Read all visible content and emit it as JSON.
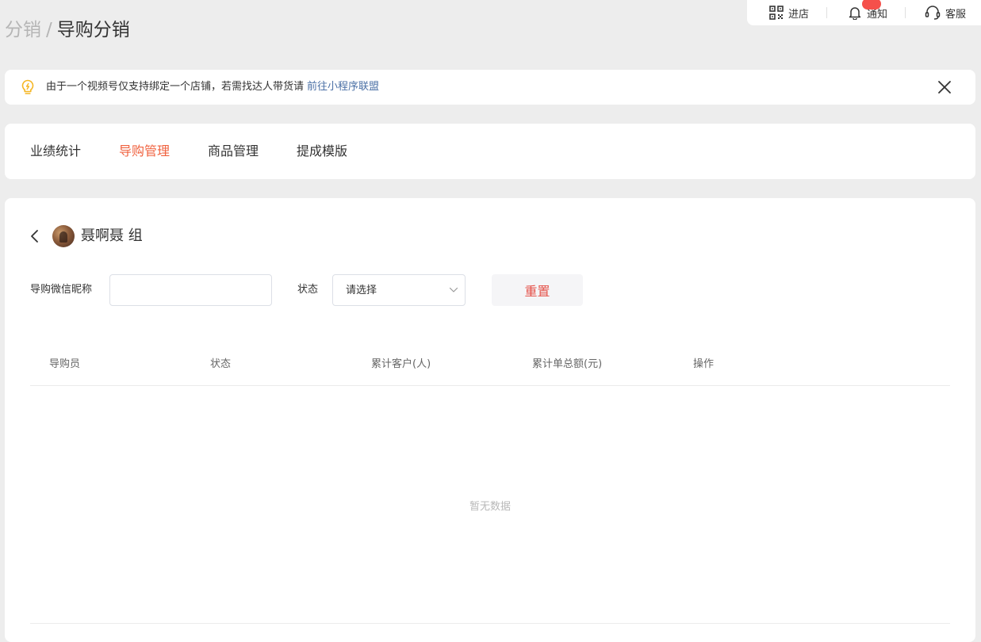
{
  "topbar": {
    "store_label": "进店",
    "notice_label": "通知",
    "notice_badge": "",
    "service_label": "客服"
  },
  "breadcrumb": {
    "parent": "分销",
    "separator": "/",
    "current": "导购分销"
  },
  "notice": {
    "text": "由于一个视频号仅支持绑定一个店铺，若需找达人带货请",
    "link": "前往小程序联盟"
  },
  "tabs": [
    {
      "label": "业绩统计"
    },
    {
      "label": "导购管理"
    },
    {
      "label": "商品管理"
    },
    {
      "label": "提成模版"
    }
  ],
  "panel": {
    "group_name": "聂啊聂 组"
  },
  "filters": {
    "nickname_label": "导购微信昵称",
    "nickname_value": "",
    "status_label": "状态",
    "status_placeholder": "请选择",
    "reset_label": "重置"
  },
  "table": {
    "columns": [
      "导购员",
      "状态",
      "累计客户(人)",
      "累计单总额(元)",
      "操作"
    ],
    "empty_text": "暂无数据"
  },
  "colors": {
    "accent": "#f0623f",
    "reset_text": "#e5534b",
    "link": "#4a6fa5",
    "badge": "#f5504b",
    "bulb": "#f5b623"
  }
}
